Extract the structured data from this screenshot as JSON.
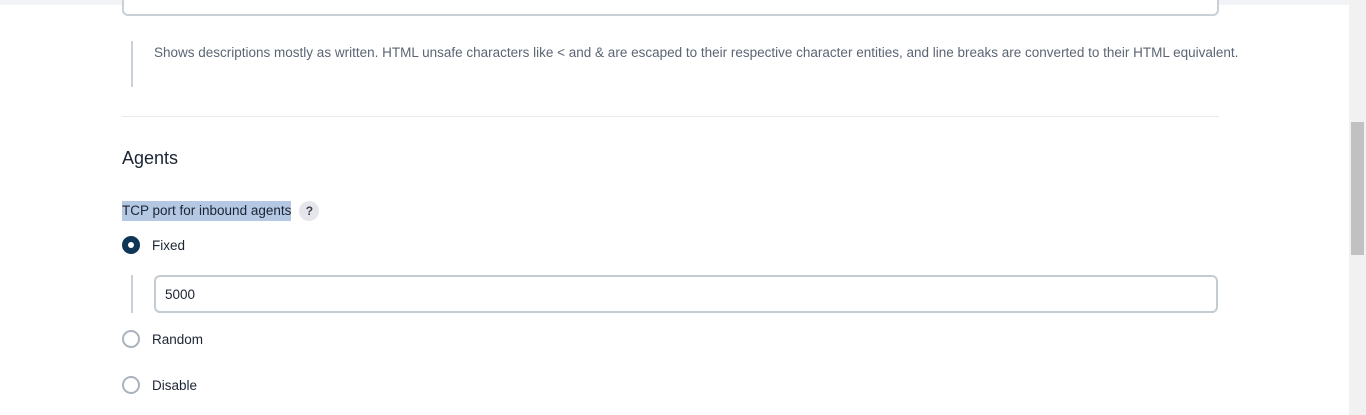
{
  "description": {
    "text": "Shows descriptions mostly as written. HTML unsafe characters like < and & are escaped to their respective character entities, and line breaks are converted to their HTML equivalent."
  },
  "agents": {
    "title": "Agents",
    "tcp_port": {
      "label": "TCP port for inbound agents",
      "help_label": "?",
      "options": [
        {
          "label": "Fixed",
          "selected": true
        },
        {
          "label": "Random",
          "selected": false
        },
        {
          "label": "Disable",
          "selected": false
        }
      ],
      "fixed_value": "5000"
    }
  },
  "colors": {
    "radio_checked": "#0f3557",
    "label_highlight": "#b4c8e4"
  }
}
